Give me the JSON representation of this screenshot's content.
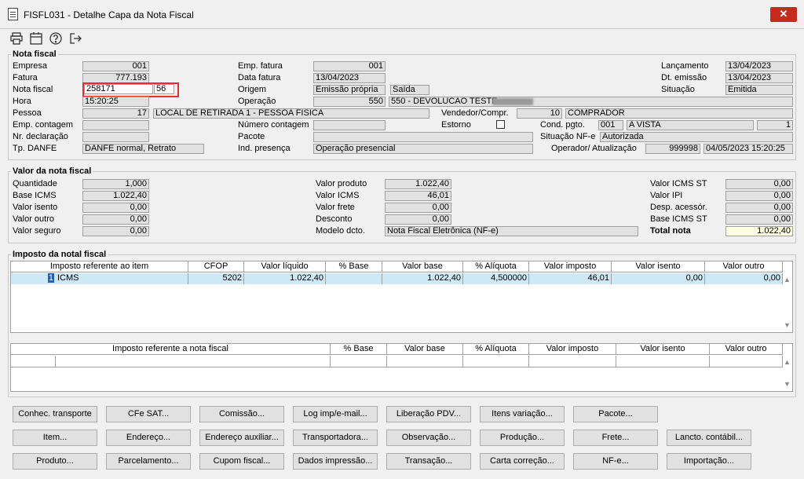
{
  "window": {
    "title": "FISFL031 - Detalhe Capa da Nota Fiscal",
    "close": "✕"
  },
  "toolbar": {
    "print": "print-icon",
    "calendar": "calendar-icon",
    "help": "help-icon",
    "exit": "exit-icon"
  },
  "nota": {
    "section": "Nota fiscal",
    "empresa_label": "Empresa",
    "empresa": "001",
    "fatura_label": "Fatura",
    "fatura": "777.193",
    "nota_label": "Nota fiscal",
    "nota": "258171",
    "serie": "56",
    "hora_label": "Hora",
    "hora": "15:20:25",
    "pessoa_label": "Pessoa",
    "pessoa_cod": "17",
    "pessoa_nome": "LOCAL DE RETIRADA 1 - PESSOA FISICA",
    "emp_contagem_label": "Emp. contagem",
    "nr_declaracao_label": "Nr. declaração",
    "tp_danfe_label": "Tp. DANFE",
    "tp_danfe": "DANFE normal, Retrato",
    "emp_fatura_label": "Emp. fatura",
    "emp_fatura": "001",
    "data_fatura_label": "Data fatura",
    "data_fatura": "13/04/2023",
    "origem_label": "Origem",
    "origem": "Emissão própria",
    "tipo": "Saída",
    "operacao_label": "Operação",
    "operacao_cod": "550",
    "operacao_desc": "550 - DEVOLUCAO TESTE",
    "vendedor_label": "Vendedor/Compr.",
    "vendedor_cod": "10",
    "vendedor_nome": "COMPRADOR",
    "numero_contagem_label": "Número contagem",
    "estorno_label": "Estorno",
    "pacote_label": "Pacote",
    "ind_presenca_label": "Ind. presença",
    "ind_presenca": "Operação presencial",
    "lancamento_label": "Lançamento",
    "lancamento": "13/04/2023",
    "dt_emissao_label": "Dt. emissão",
    "dt_emissao": "13/04/2023",
    "situacao_label": "Situação",
    "situacao": "Emitida",
    "cond_pgto_label": "Cond. pgto.",
    "cond_pgto_cod": "001",
    "cond_pgto_desc": "A VISTA",
    "cond_pgto_qtd": "1",
    "situacao_nfe_label": "Situação NF-e",
    "situacao_nfe": "Autorizada",
    "operador_label": "Operador/ Atualização",
    "operador": "999998",
    "atualizacao": "04/05/2023 15:20:25"
  },
  "valor": {
    "section": "Valor da nota fiscal",
    "quantidade_label": "Quantidade",
    "quantidade": "1,000",
    "base_icms_label": "Base ICMS",
    "base_icms": "1.022,40",
    "valor_isento_label": "Valor isento",
    "valor_isento": "0,00",
    "valor_outro_label": "Valor outro",
    "valor_outro": "0,00",
    "valor_seguro_label": "Valor seguro",
    "valor_seguro": "0,00",
    "valor_produto_label": "Valor produto",
    "valor_produto": "1.022,40",
    "valor_icms_label": "Valor ICMS",
    "valor_icms": "46,01",
    "valor_frete_label": "Valor frete",
    "valor_frete": "0,00",
    "desconto_label": "Desconto",
    "desconto": "0,00",
    "modelo_label": "Modelo dcto.",
    "modelo": "Nota Fiscal Eletrônica (NF-e)",
    "valor_icms_st_label": "Valor ICMS ST",
    "valor_icms_st": "0,00",
    "valor_ipi_label": "Valor IPI",
    "valor_ipi": "0,00",
    "desp_acessor_label": "Desp. acessór.",
    "desp_acessor": "0,00",
    "base_icms_st_label": "Base ICMS ST",
    "base_icms_st": "0,00",
    "total_label": "Total nota",
    "total": "1.022,40"
  },
  "imposto": {
    "section": "Imposto da notal fiscal",
    "item_headers": [
      "Imposto referente ao item",
      "CFOP",
      "Valor líquido",
      "% Base",
      "Valor base",
      "% Alíquota",
      "Valor imposto",
      "Valor isento",
      "Valor outro"
    ],
    "item_row": [
      "1",
      "ICMS",
      "5202",
      "1.022,40",
      "",
      "1.022,40",
      "4,500000",
      "46,01",
      "0,00",
      "0,00"
    ],
    "nota_headers": [
      "Imposto referente a nota fiscal",
      "% Base",
      "Valor base",
      "% Alíquota",
      "Valor imposto",
      "Valor isento",
      "Valor outro"
    ]
  },
  "buttons": [
    [
      "Conhec. transporte",
      "CFe SAT...",
      "Comissão...",
      "Log imp/e-mail...",
      "Liberação PDV...",
      "Itens variação...",
      "Pacote..."
    ],
    [
      "Item...",
      "Endereço...",
      "Endereço auxiliar...",
      "Transportadora...",
      "Observação...",
      "Produção...",
      "Frete...",
      "Lancto. contábil..."
    ],
    [
      "Produto...",
      "Parcelamento...",
      "Cupom fiscal...",
      "Dados impressão...",
      "Transação...",
      "Carta correção...",
      "NF-e...",
      "Importação..."
    ]
  ]
}
